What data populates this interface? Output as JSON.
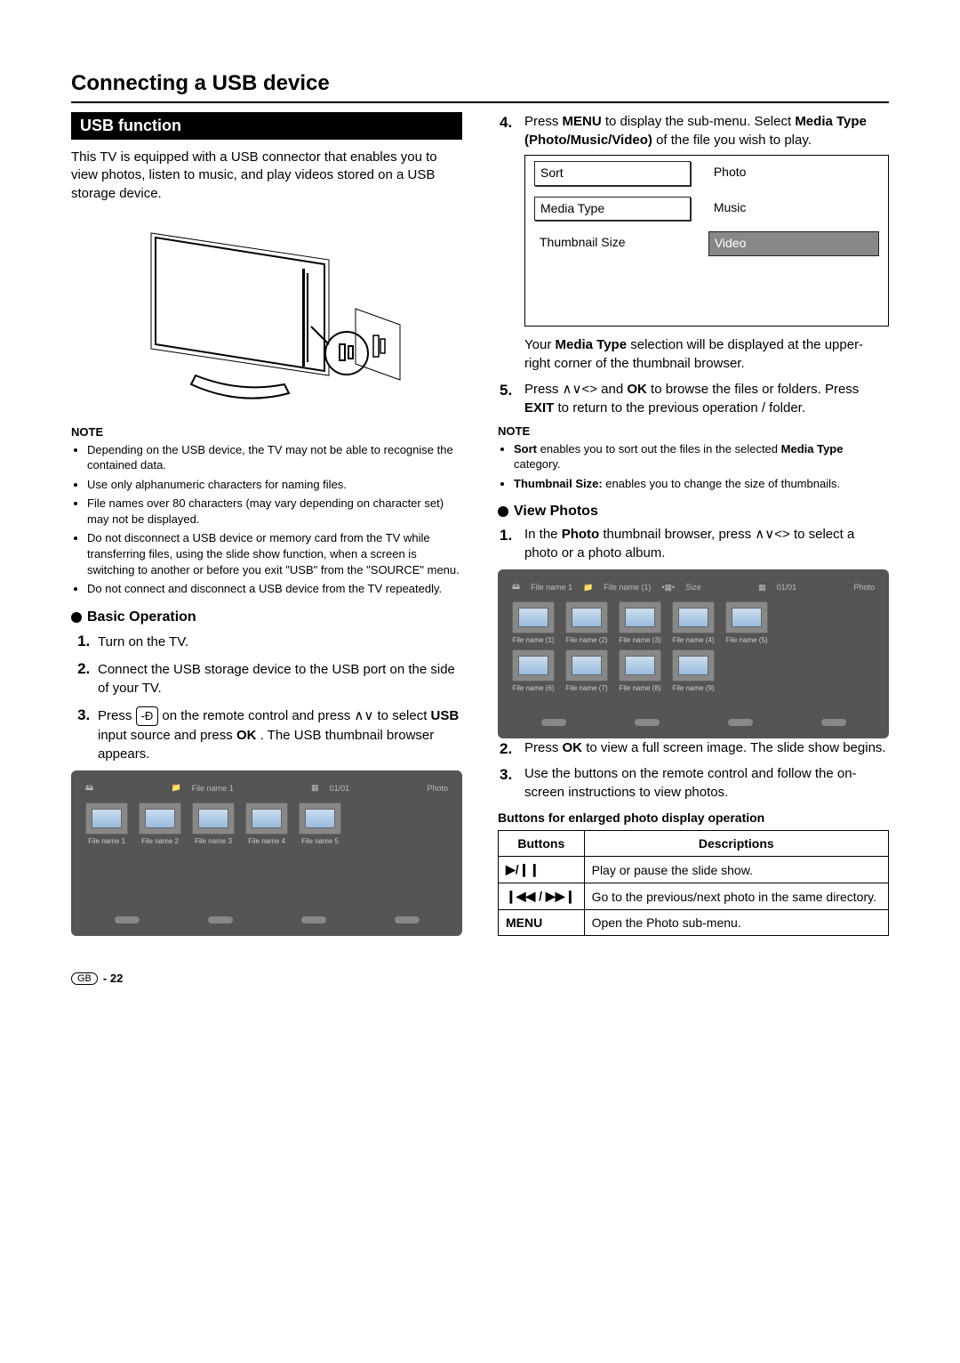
{
  "title": "Connecting a USB device",
  "section_bar": "USB function",
  "intro": "This TV is equipped with a USB connector that enables you to view photos, listen to music, and play videos stored on a USB storage device.",
  "note_label": "NOTE",
  "notes_left": [
    "Depending on the USB device, the TV may not be able to recognise the contained data.",
    "Use only alphanumeric characters for naming files.",
    "File names over 80 characters (may vary depending on character set) may not be displayed.",
    "Do not disconnect a USB device or memory card from the TV while transferring files, using the slide show function, when a screen is switching to another or before you exit \"USB\" from the \"SOURCE\" menu.",
    "Do not connect and disconnect a USB device from the TV repeatedly."
  ],
  "basic_op": "Basic Operation",
  "steps_left": [
    "Turn on the TV.",
    "Connect the USB storage device to the USB port on the side of your TV."
  ],
  "step3_a": "Press ",
  "step3_b": " on the remote control and press ",
  "step3_c": " to select ",
  "step3_usb": "USB",
  "step3_d": " input source and press ",
  "step3_ok": "OK",
  "step3_e": ". The USB thumbnail browser appears.",
  "arrows_ud": "∧∨",
  "arrows_full": "∧∨<>",
  "browser1": {
    "folder": "File name 1",
    "page": "01/01",
    "mode": "Photo",
    "thumbs": [
      "File name 1",
      "File name 2",
      "File name 3",
      "File name 4",
      "File name 5"
    ]
  },
  "step4_a": "Press ",
  "step4_menu": "MENU",
  "step4_b": " to display the sub-menu. Select ",
  "step4_media": "Media Type (Photo/Music/Video)",
  "step4_c": " of the file you wish to play.",
  "menu_table": {
    "left": [
      "Sort",
      "Media Type",
      "Thumbnail Size"
    ],
    "right": [
      "Photo",
      "Music",
      "Video"
    ]
  },
  "step4_post_a": "Your ",
  "step4_post_b": "Media Type",
  "step4_post_c": " selection will be displayed at the upper-right corner of the thumbnail browser.",
  "step5_a": "Press ",
  "step5_b": " and ",
  "step5_ok": "OK",
  "step5_c": " to browse the files or folders. Press ",
  "step5_exit": "EXIT",
  "step5_d": " to return to the previous operation / folder.",
  "notes_right_sort_b": "Sort",
  "notes_right_sort_t": " enables you to sort out the files in the selected ",
  "notes_right_sort_mt": "Media Type",
  "notes_right_sort_end": " category.",
  "notes_right_thumb_b": "Thumbnail Size:",
  "notes_right_thumb_t": " enables you to change the size of thumbnails.",
  "view_photos": "View Photos",
  "vp1_a": "In the ",
  "vp1_photo": "Photo",
  "vp1_b": " thumbnail browser, press ",
  "vp1_c": " to select a photo or a photo album.",
  "browser2": {
    "folder": "File name 1",
    "sub": "File name (1)",
    "size": "Size",
    "page": "01/01",
    "mode": "Photo",
    "thumbs": [
      "File name (1)",
      "File name (2)",
      "File name (3)",
      "File name (4)",
      "File name (5)",
      "File name (6)",
      "File name (7)",
      "File name (8)",
      "File name (9)"
    ]
  },
  "vp2_a": "Press ",
  "vp2_ok": "OK",
  "vp2_b": " to view a full screen image. The slide show begins.",
  "vp3": "Use the buttons on the remote control and follow the on-screen instructions to view photos.",
  "btns_caption": "Buttons for enlarged photo display operation",
  "btn_table": {
    "head": [
      "Buttons",
      "Descriptions"
    ],
    "rows": [
      {
        "btn": "▶/❙❙",
        "desc": "Play or pause the slide show."
      },
      {
        "btn": "❙◀◀ / ▶▶❙",
        "desc": "Go to the previous/next photo in the same directory."
      },
      {
        "btn": "MENU",
        "desc": "Open the Photo sub-menu."
      }
    ]
  },
  "footer_gb": "GB",
  "footer_page": "- 22"
}
